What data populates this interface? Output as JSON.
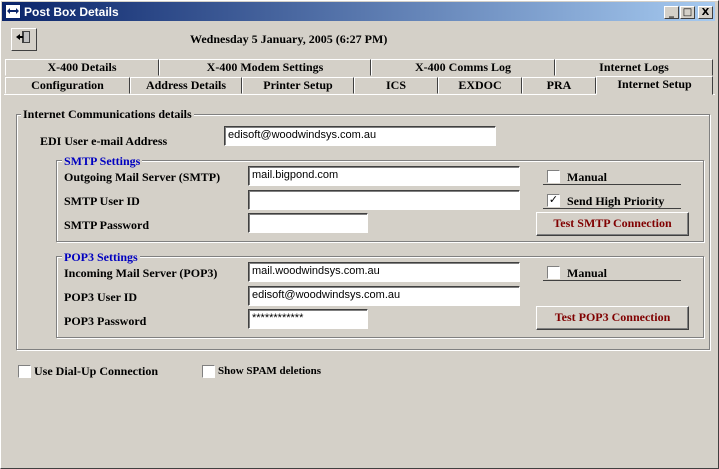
{
  "window": {
    "title": "Post Box Details",
    "minimize": "_",
    "maximize": "□",
    "close": "X"
  },
  "header": {
    "datetime": "Wednesday 5 January, 2005  (6:27 PM)"
  },
  "tabs_row1": [
    "X-400 Details",
    "X-400 Modem Settings",
    "X-400 Comms Log",
    "Internet Logs"
  ],
  "tabs_row2": [
    "Configuration",
    "Address Details",
    "Printer Setup",
    "ICS",
    "EXDOC",
    "PRA",
    "Internet Setup"
  ],
  "internet": {
    "group_title": "Internet Communications details",
    "edi_label": "EDI User e-mail Address",
    "edi_value": "edisoft@woodwindsys.com.au"
  },
  "smtp": {
    "title": "SMTP Settings",
    "server_label": "Outgoing Mail Server (SMTP)",
    "server_value": "mail.bigpond.com",
    "user_label": "SMTP User ID",
    "user_value": "",
    "pass_label": "SMTP Password",
    "pass_value": "",
    "manual_label": "Manual",
    "manual_checked": false,
    "priority_label": "Send High Priority",
    "priority_checked": true,
    "test_button": "Test SMTP Connection"
  },
  "pop3": {
    "title": "POP3 Settings",
    "server_label": "Incoming Mail Server (POP3)",
    "server_value": "mail.woodwindsys.com.au",
    "user_label": "POP3 User ID",
    "user_value": "edisoft@woodwindsys.com.au",
    "pass_label": "POP3 Password",
    "pass_value": "************",
    "manual_label": "Manual",
    "manual_checked": false,
    "test_button": "Test POP3 Connection"
  },
  "options": {
    "dialup_label": "Use Dial-Up Connection",
    "dialup_checked": false,
    "spam_label": "Show SPAM deletions",
    "spam_checked": false
  },
  "check_mark": "✓",
  "colors": {
    "title_bar": "#0a246a",
    "section_title": "#0000c0",
    "button_text": "#800000"
  }
}
